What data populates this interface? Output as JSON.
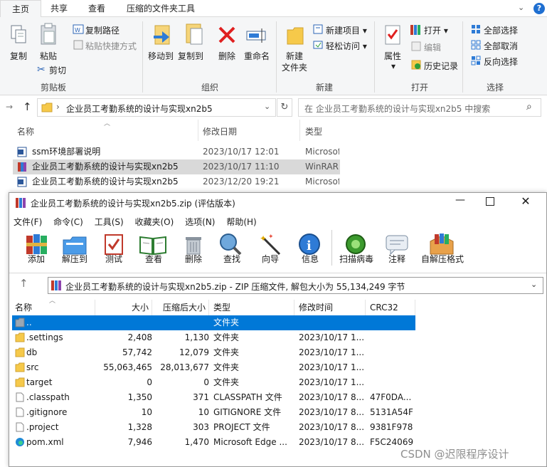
{
  "ribbon": {
    "tabs": [
      "主页",
      "共享",
      "查看",
      "压缩的文件夹工具"
    ],
    "clipboard": {
      "copy": "复制",
      "paste": "粘贴",
      "copy_path": "复制路径",
      "paste_shortcut": "粘贴快捷方式",
      "cut": "剪切",
      "group": "剪贴板"
    },
    "organize": {
      "move_to": "移动到",
      "copy_to": "复制到",
      "delete": "删除",
      "rename": "重命名",
      "group": "组织"
    },
    "new": {
      "new_folder_line1": "新建",
      "new_folder_line2": "文件夹",
      "new_item": "新建项目",
      "easy_access": "轻松访问",
      "group": "新建"
    },
    "open": {
      "properties": "属性",
      "open": "打开",
      "edit": "编辑",
      "history": "历史记录",
      "group": "打开"
    },
    "select": {
      "select_all": "全部选择",
      "select_none": "全部取消",
      "invert": "反向选择",
      "group": "选择"
    }
  },
  "addressbar": {
    "path": "企业员工考勤系统的设计与实现xn2b5",
    "search_placeholder": "在 企业员工考勤系统的设计与实现xn2b5 中搜索"
  },
  "explorer": {
    "headers": {
      "name": "名称",
      "date": "修改日期",
      "type": "类型"
    },
    "rows": [
      {
        "name": "ssm环境部署说明",
        "date": "2023/10/17 12:01",
        "type": "Microsoft"
      },
      {
        "name": "企业员工考勤系统的设计与实现xn2b5",
        "date": "2023/10/17 11:10",
        "type": "WinRAR"
      },
      {
        "name": "企业员工考勤系统的设计与实现xn2b5",
        "date": "2023/12/20 19:21",
        "type": "Microsoft"
      }
    ]
  },
  "winrar": {
    "title": "企业员工考勤系统的设计与实现xn2b5.zip (评估版本)",
    "menu": [
      "文件(F)",
      "命令(C)",
      "工具(S)",
      "收藏夹(O)",
      "选项(N)",
      "帮助(H)"
    ],
    "toolbar": [
      "添加",
      "解压到",
      "测试",
      "查看",
      "删除",
      "查找",
      "向导",
      "信息",
      "扫描病毒",
      "注释",
      "自解压格式"
    ],
    "path": "企业员工考勤系统的设计与实现xn2b5.zip - ZIP 压缩文件, 解包大小为 55,134,249 字节",
    "headers": {
      "name": "名称",
      "size": "大小",
      "packed": "压缩后大小",
      "type": "类型",
      "modified": "修改时间",
      "crc": "CRC32"
    },
    "files": [
      {
        "name": "..",
        "size": "",
        "packed": "",
        "type": "文件夹",
        "modified": "",
        "crc": ""
      },
      {
        "name": ".settings",
        "size": "2,408",
        "packed": "1,130",
        "type": "文件夹",
        "modified": "2023/10/17 1...",
        "crc": ""
      },
      {
        "name": "db",
        "size": "57,742",
        "packed": "12,079",
        "type": "文件夹",
        "modified": "2023/10/17 1...",
        "crc": ""
      },
      {
        "name": "src",
        "size": "55,063,465",
        "packed": "28,013,677",
        "type": "文件夹",
        "modified": "2023/10/17 1...",
        "crc": ""
      },
      {
        "name": "target",
        "size": "0",
        "packed": "0",
        "type": "文件夹",
        "modified": "2023/10/17 1...",
        "crc": ""
      },
      {
        "name": ".classpath",
        "size": "1,350",
        "packed": "371",
        "type": "CLASSPATH 文件",
        "modified": "2023/10/17 8...",
        "crc": "47F0DA..."
      },
      {
        "name": ".gitignore",
        "size": "10",
        "packed": "10",
        "type": "GITIGNORE 文件",
        "modified": "2023/10/17 8...",
        "crc": "5131A54F"
      },
      {
        "name": ".project",
        "size": "1,328",
        "packed": "303",
        "type": "PROJECT 文件",
        "modified": "2023/10/17 8...",
        "crc": "9381F978"
      },
      {
        "name": "pom.xml",
        "size": "7,946",
        "packed": "1,470",
        "type": "Microsoft Edge ...",
        "modified": "2023/10/17 8...",
        "crc": "F5C24069"
      }
    ]
  },
  "watermark": "CSDN @迟限程序设计"
}
